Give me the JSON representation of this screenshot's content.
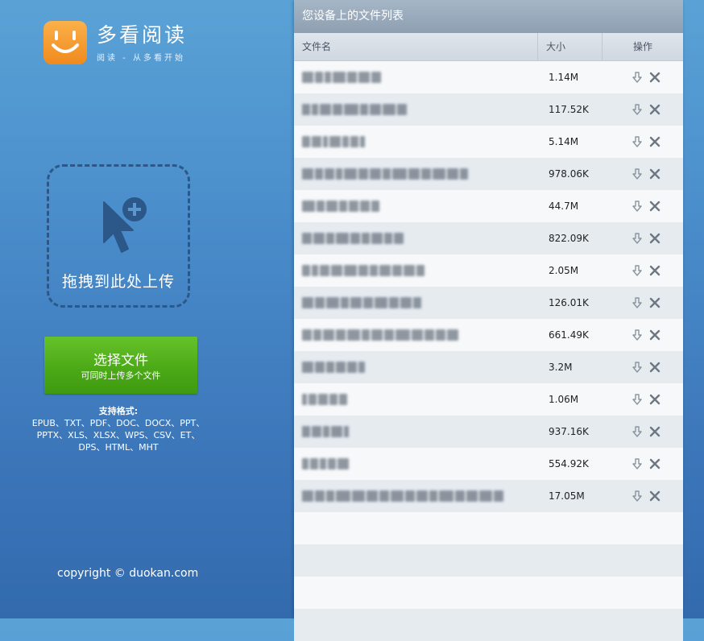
{
  "brand": {
    "title": "多看阅读",
    "slogan": "阅读 - 从多看开始",
    "logo_icon": "smile-logo-icon",
    "accent": "#f39a2b"
  },
  "dropzone": {
    "label": "拖拽到此处上传",
    "icon": "cursor-plus-icon"
  },
  "select_button": {
    "label": "选择文件",
    "sublabel": "可同时上传多个文件",
    "color": "#4fab18"
  },
  "formats": {
    "title": "支持格式:",
    "lines": [
      "EPUB、TXT、PDF、DOC、DOCX、PPT、",
      "PPTX、XLS、XLSX、WPS、CSV、ET、",
      "DPS、HTML、MHT"
    ]
  },
  "copyright": "copyright © duokan.com",
  "panel": {
    "title": "您设备上的文件列表",
    "columns": {
      "name": "文件名",
      "size": "大小",
      "ops": "操作"
    },
    "files": [
      {
        "size": "1.14M"
      },
      {
        "size": "117.52K"
      },
      {
        "size": "5.14M"
      },
      {
        "size": "978.06K"
      },
      {
        "size": "44.7M"
      },
      {
        "size": "822.09K"
      },
      {
        "size": "2.05M"
      },
      {
        "size": "126.01K"
      },
      {
        "size": "661.49K"
      },
      {
        "size": "3.2M"
      },
      {
        "size": "1.06M"
      },
      {
        "size": "937.16K"
      },
      {
        "size": "554.92K"
      },
      {
        "size": "17.05M"
      }
    ],
    "row_icons": [
      "download-icon",
      "delete-icon"
    ]
  }
}
